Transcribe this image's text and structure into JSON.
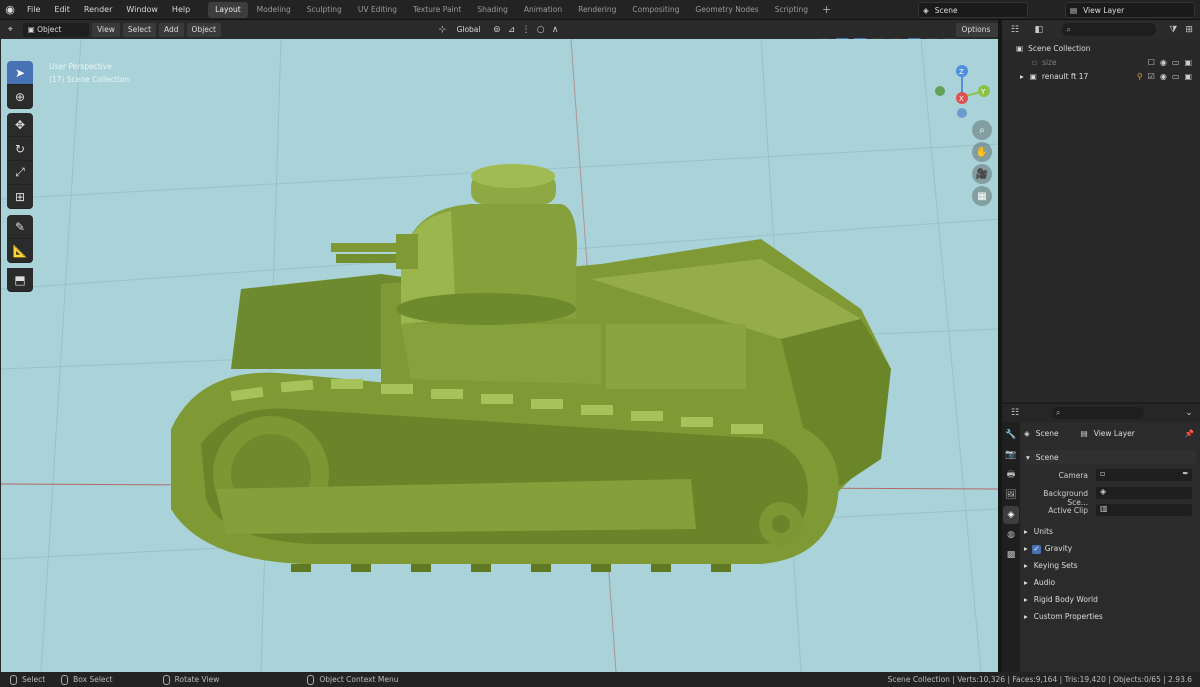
{
  "menu": [
    "File",
    "Edit",
    "Render",
    "Window",
    "Help"
  ],
  "workspaces": [
    {
      "label": "Layout",
      "active": true
    },
    {
      "label": "Modeling"
    },
    {
      "label": "Sculpting"
    },
    {
      "label": "UV Editing"
    },
    {
      "label": "Texture Paint"
    },
    {
      "label": "Shading"
    },
    {
      "label": "Animation"
    },
    {
      "label": "Rendering"
    },
    {
      "label": "Compositing"
    },
    {
      "label": "Geometry Nodes"
    },
    {
      "label": "Scripting"
    }
  ],
  "scene_name": "Scene",
  "view_layer_name": "View Layer",
  "viewport_header": {
    "mode": "Object Mode",
    "menus": [
      "View",
      "Select",
      "Add",
      "Object"
    ],
    "transform_orientation": "Global",
    "options_label": "Options"
  },
  "viewport": {
    "perspective_label": "User Perspective",
    "collection_label": "(17) Scene Collection",
    "background": "#a9d3d8",
    "tank_color": "#7f9a35",
    "gizmo": {
      "z": "Z",
      "y": "Y",
      "x": "X"
    }
  },
  "outliner": {
    "root": "Scene Collection",
    "items": [
      {
        "label": "size"
      },
      {
        "label": "renault ft 17"
      }
    ]
  },
  "properties": {
    "breadcrumb_scene": "Scene",
    "breadcrumb_viewlayer": "View Layer",
    "panel_title": "Scene",
    "fields": [
      {
        "label": "Camera"
      },
      {
        "label": "Background Sce..."
      },
      {
        "label": "Active Clip"
      }
    ],
    "subpanels": [
      "Units",
      "Gravity",
      "Keying Sets",
      "Audio",
      "Rigid Body World",
      "Custom Properties"
    ]
  },
  "statusbar": {
    "select": "Select",
    "box_select": "Box Select",
    "rotate_view": "Rotate View",
    "context_menu": "Object Context Menu",
    "stats": "Scene Collection | Verts:10,326 | Faces:9,164 | Tris:19,420 | Objects:0/65 | 2.93.6"
  },
  "colors": {
    "accent": "#4772b3",
    "x_axis": "#e05050",
    "y_axis": "#8bc34a",
    "z_axis": "#4f8ee0"
  }
}
